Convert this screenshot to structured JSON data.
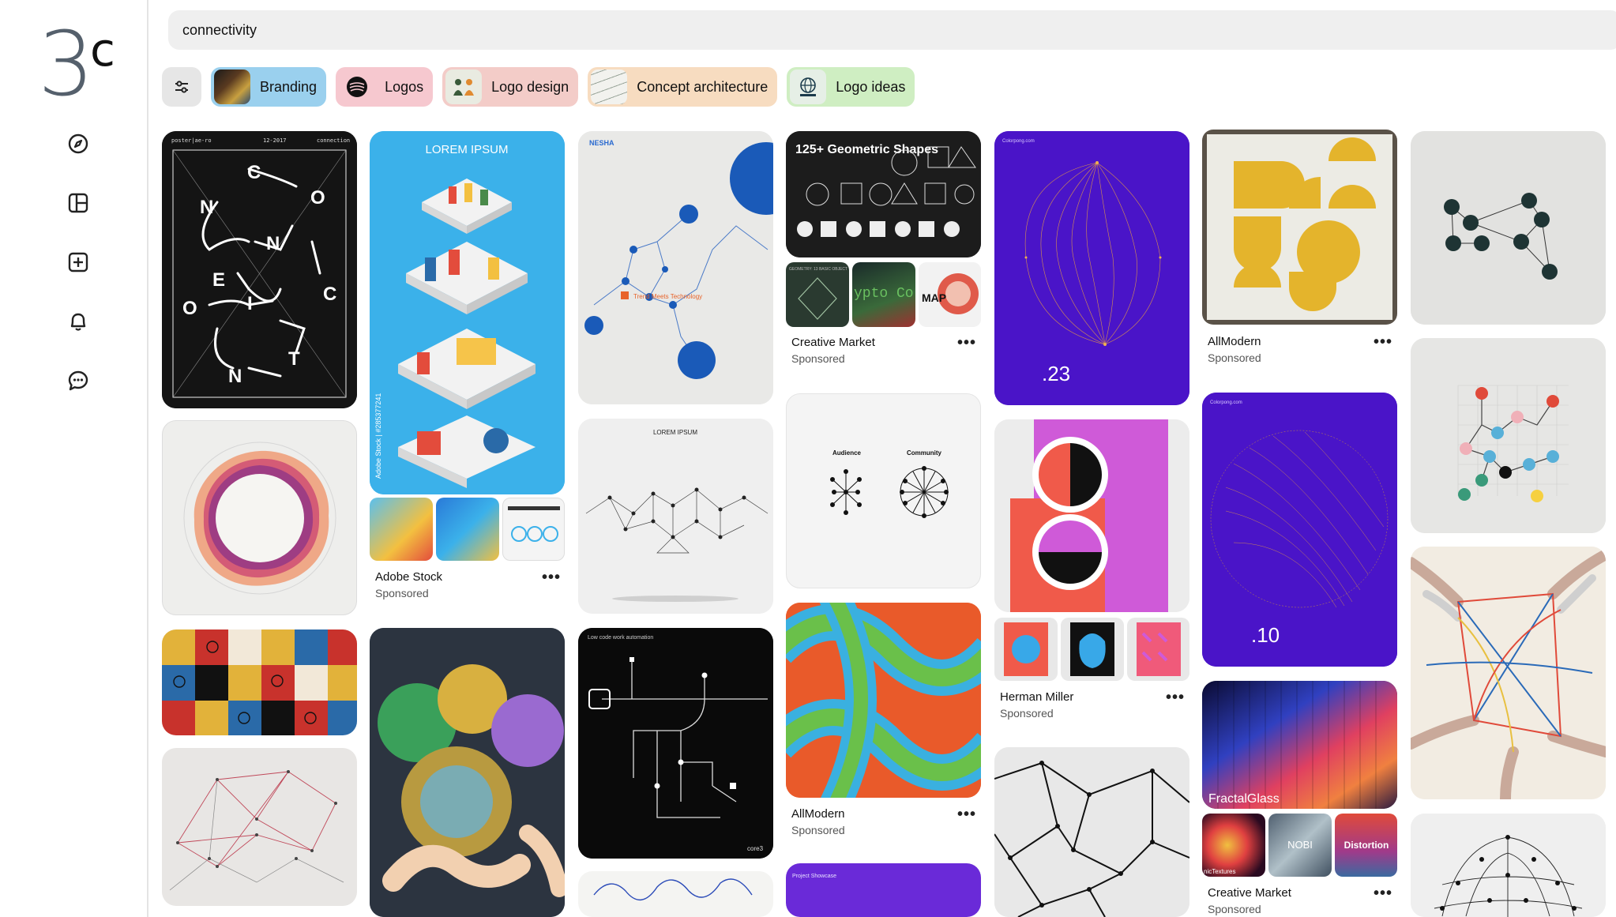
{
  "app": {
    "logo_main": "3",
    "logo_sup": "c"
  },
  "nav": [
    {
      "name": "explore-icon"
    },
    {
      "name": "boards-icon"
    },
    {
      "name": "create-icon"
    },
    {
      "name": "notifications-icon"
    },
    {
      "name": "messages-icon"
    }
  ],
  "search": {
    "value": "connectivity"
  },
  "chips": [
    {
      "label": "Branding",
      "color": "#9ad0ee"
    },
    {
      "label": "Logos",
      "color": "#f6c8cf"
    },
    {
      "label": "Logo design",
      "color": "#f3ccc8"
    },
    {
      "label": "Concept architecture",
      "color": "#f7dcc0"
    },
    {
      "label": "Logo ideas",
      "color": "#cfeec2"
    }
  ],
  "pins": {
    "lorem_title": "LOREM IPSUM",
    "adobe_vertical": "Adobe Stock | #285377241",
    "adobe": {
      "title": "Adobe Stock",
      "sub": "Sponsored"
    },
    "nesha_brand": "NESHA",
    "nesha_caption": "Trend Meets Technology",
    "handshake_title": "LOREM IPSUM",
    "geometric_title": "125+ Geometric Shapes",
    "geometric_sub": "GEOMETRY: 13 BASIC OBJECT",
    "crypto_text": "ypto Co",
    "map_text": "MAP",
    "creative1": {
      "title": "Creative Market",
      "sub": "Sponsored"
    },
    "audience_label": "Audience",
    "community_label": "Community",
    "allmodern1": {
      "title": "AllModern",
      "sub": "Sponsored"
    },
    "purple1_num": ".23",
    "purple1_brand": "Colorpong.com",
    "herman": {
      "title": "Herman Miller",
      "sub": "Sponsored"
    },
    "allmodern2": {
      "title": "AllModern",
      "sub": "Sponsored"
    },
    "purple2_num": ".10",
    "purple2_brand": "Colorpong.com",
    "fractal_label": "FractalGlass",
    "nobi_text": "NOBI",
    "distortion_text": "Distortion",
    "nic_text": "nicTextures",
    "creative2": {
      "title": "Creative Market",
      "sub": "Sponsored"
    },
    "connection_letters": [
      "C",
      "O",
      "N",
      "N",
      "E",
      "C",
      "T",
      "I",
      "O",
      "N"
    ],
    "poster_head_left": "poster|ae-ro",
    "poster_head_mid": "12-2017",
    "poster_head_right": "connection",
    "lowcode_caption": "Low code work automation",
    "core_label": "core3",
    "project_label": "Project Showcase",
    "more_dots": "•••"
  }
}
